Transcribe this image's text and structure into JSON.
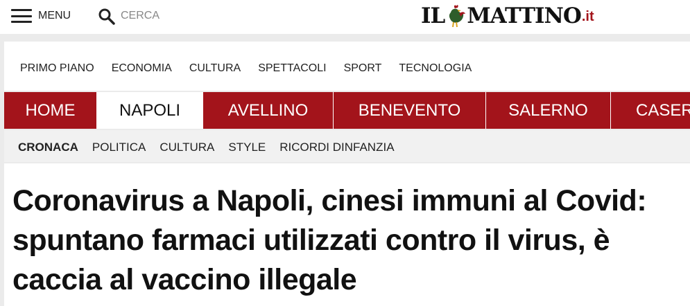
{
  "topbar": {
    "menu_label": "MENU",
    "search_placeholder": "CERCA",
    "logo": {
      "part1": "IL",
      "part2": "MATTINO",
      "tld": ".it",
      "brand_color": "#a3141b"
    }
  },
  "primary_nav": [
    "PRIMO PIANO",
    "ECONOMIA",
    "CULTURA",
    "SPETTACOLI",
    "SPORT",
    "TECNOLOGIA"
  ],
  "city_tabs": [
    {
      "label": "HOME",
      "active": false
    },
    {
      "label": "NAPOLI",
      "active": true
    },
    {
      "label": "AVELLINO",
      "active": false
    },
    {
      "label": "BENEVENTO",
      "active": false
    },
    {
      "label": "SALERNO",
      "active": false
    },
    {
      "label": "CASERT",
      "active": false
    }
  ],
  "sub_nav": [
    {
      "label": "CRONACA",
      "active": true
    },
    {
      "label": "POLITICA",
      "active": false
    },
    {
      "label": "CULTURA",
      "active": false
    },
    {
      "label": "STYLE",
      "active": false
    },
    {
      "label": "RICORDI DINFANZIA",
      "active": false
    }
  ],
  "article": {
    "headline": "Coronavirus a Napoli, cinesi immuni al Covid: spuntano farmaci utilizzati contro il virus, è caccia al vaccino illegale"
  },
  "icons": {
    "menu": "hamburger-icon",
    "search": "search-icon",
    "logo": "rooster-icon"
  }
}
